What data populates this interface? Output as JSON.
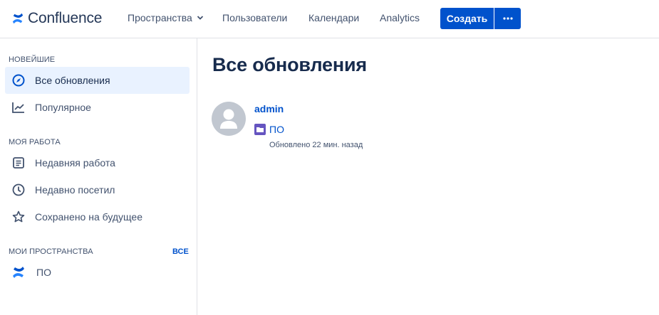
{
  "header": {
    "app_name": "Confluence",
    "nav": {
      "spaces": "Пространства",
      "people": "Пользователи",
      "calendars": "Календари",
      "analytics": "Analytics"
    },
    "create_label": "Создать",
    "more_label": "•••"
  },
  "sidebar": {
    "section_newest": "НОВЕЙШИЕ",
    "all_updates": "Все обновления",
    "popular": "Популярное",
    "section_my_work": "МОЯ РАБОТА",
    "recent_work": "Недавняя работа",
    "recently_visited": "Недавно посетил",
    "saved_for_later": "Сохранено на будущее",
    "section_my_spaces": "МОИ ПРОСТРАНСТВА",
    "all_link": "ВСЕ",
    "space_po": "ПО"
  },
  "main": {
    "title": "Все обновления",
    "feed": [
      {
        "author": "admin",
        "space": "ПО",
        "updated": "Обновлено 22 мин. назад"
      }
    ]
  },
  "colors": {
    "accent": "#0052cc",
    "active_bg": "#e9f2ff",
    "space_badge": "#6554c0"
  }
}
